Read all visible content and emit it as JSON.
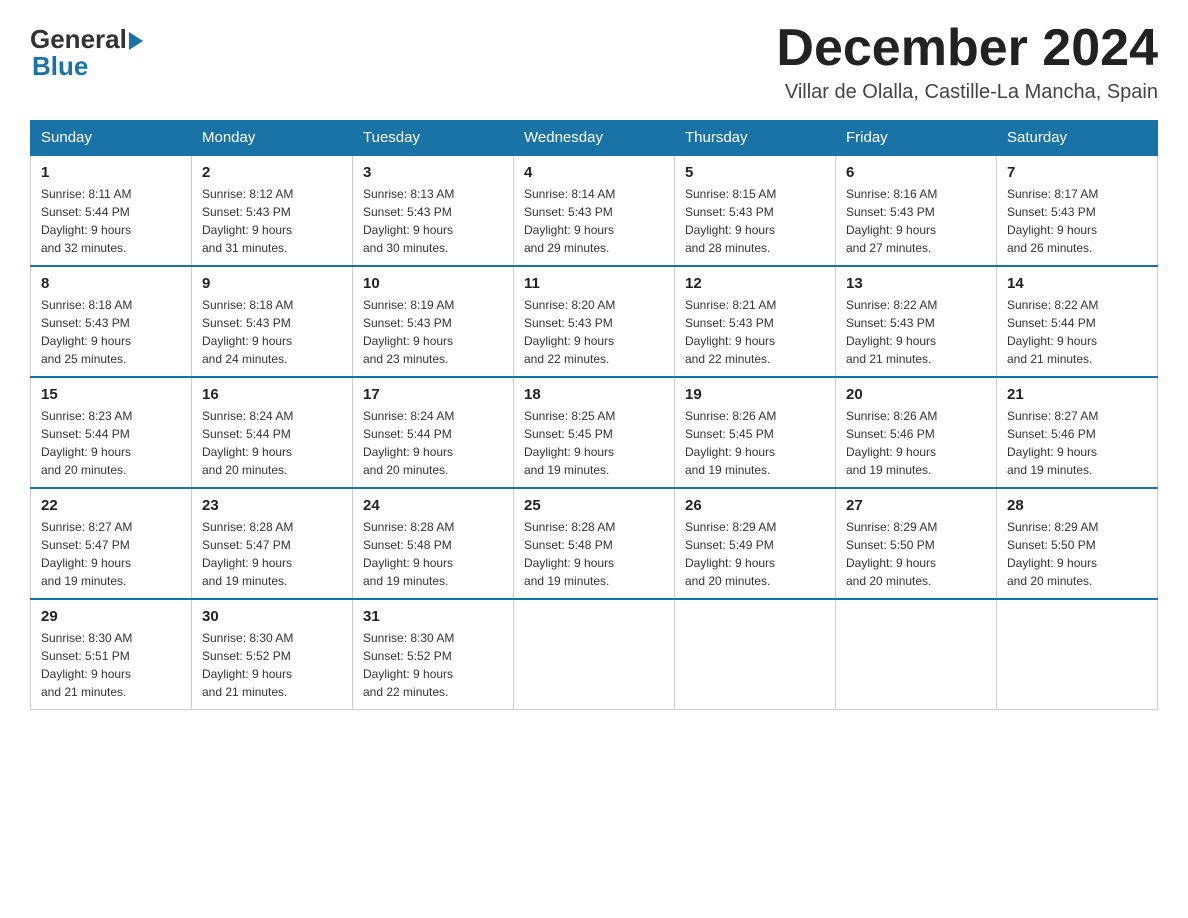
{
  "header": {
    "title": "December 2024",
    "location": "Villar de Olalla, Castille-La Mancha, Spain",
    "logo_general": "General",
    "logo_blue": "Blue"
  },
  "days_of_week": [
    "Sunday",
    "Monday",
    "Tuesday",
    "Wednesday",
    "Thursday",
    "Friday",
    "Saturday"
  ],
  "weeks": [
    [
      {
        "day": "1",
        "sunrise": "8:11 AM",
        "sunset": "5:44 PM",
        "daylight": "9 hours and 32 minutes."
      },
      {
        "day": "2",
        "sunrise": "8:12 AM",
        "sunset": "5:43 PM",
        "daylight": "9 hours and 31 minutes."
      },
      {
        "day": "3",
        "sunrise": "8:13 AM",
        "sunset": "5:43 PM",
        "daylight": "9 hours and 30 minutes."
      },
      {
        "day": "4",
        "sunrise": "8:14 AM",
        "sunset": "5:43 PM",
        "daylight": "9 hours and 29 minutes."
      },
      {
        "day": "5",
        "sunrise": "8:15 AM",
        "sunset": "5:43 PM",
        "daylight": "9 hours and 28 minutes."
      },
      {
        "day": "6",
        "sunrise": "8:16 AM",
        "sunset": "5:43 PM",
        "daylight": "9 hours and 27 minutes."
      },
      {
        "day": "7",
        "sunrise": "8:17 AM",
        "sunset": "5:43 PM",
        "daylight": "9 hours and 26 minutes."
      }
    ],
    [
      {
        "day": "8",
        "sunrise": "8:18 AM",
        "sunset": "5:43 PM",
        "daylight": "9 hours and 25 minutes."
      },
      {
        "day": "9",
        "sunrise": "8:18 AM",
        "sunset": "5:43 PM",
        "daylight": "9 hours and 24 minutes."
      },
      {
        "day": "10",
        "sunrise": "8:19 AM",
        "sunset": "5:43 PM",
        "daylight": "9 hours and 23 minutes."
      },
      {
        "day": "11",
        "sunrise": "8:20 AM",
        "sunset": "5:43 PM",
        "daylight": "9 hours and 22 minutes."
      },
      {
        "day": "12",
        "sunrise": "8:21 AM",
        "sunset": "5:43 PM",
        "daylight": "9 hours and 22 minutes."
      },
      {
        "day": "13",
        "sunrise": "8:22 AM",
        "sunset": "5:43 PM",
        "daylight": "9 hours and 21 minutes."
      },
      {
        "day": "14",
        "sunrise": "8:22 AM",
        "sunset": "5:44 PM",
        "daylight": "9 hours and 21 minutes."
      }
    ],
    [
      {
        "day": "15",
        "sunrise": "8:23 AM",
        "sunset": "5:44 PM",
        "daylight": "9 hours and 20 minutes."
      },
      {
        "day": "16",
        "sunrise": "8:24 AM",
        "sunset": "5:44 PM",
        "daylight": "9 hours and 20 minutes."
      },
      {
        "day": "17",
        "sunrise": "8:24 AM",
        "sunset": "5:44 PM",
        "daylight": "9 hours and 20 minutes."
      },
      {
        "day": "18",
        "sunrise": "8:25 AM",
        "sunset": "5:45 PM",
        "daylight": "9 hours and 19 minutes."
      },
      {
        "day": "19",
        "sunrise": "8:26 AM",
        "sunset": "5:45 PM",
        "daylight": "9 hours and 19 minutes."
      },
      {
        "day": "20",
        "sunrise": "8:26 AM",
        "sunset": "5:46 PM",
        "daylight": "9 hours and 19 minutes."
      },
      {
        "day": "21",
        "sunrise": "8:27 AM",
        "sunset": "5:46 PM",
        "daylight": "9 hours and 19 minutes."
      }
    ],
    [
      {
        "day": "22",
        "sunrise": "8:27 AM",
        "sunset": "5:47 PM",
        "daylight": "9 hours and 19 minutes."
      },
      {
        "day": "23",
        "sunrise": "8:28 AM",
        "sunset": "5:47 PM",
        "daylight": "9 hours and 19 minutes."
      },
      {
        "day": "24",
        "sunrise": "8:28 AM",
        "sunset": "5:48 PM",
        "daylight": "9 hours and 19 minutes."
      },
      {
        "day": "25",
        "sunrise": "8:28 AM",
        "sunset": "5:48 PM",
        "daylight": "9 hours and 19 minutes."
      },
      {
        "day": "26",
        "sunrise": "8:29 AM",
        "sunset": "5:49 PM",
        "daylight": "9 hours and 20 minutes."
      },
      {
        "day": "27",
        "sunrise": "8:29 AM",
        "sunset": "5:50 PM",
        "daylight": "9 hours and 20 minutes."
      },
      {
        "day": "28",
        "sunrise": "8:29 AM",
        "sunset": "5:50 PM",
        "daylight": "9 hours and 20 minutes."
      }
    ],
    [
      {
        "day": "29",
        "sunrise": "8:30 AM",
        "sunset": "5:51 PM",
        "daylight": "9 hours and 21 minutes."
      },
      {
        "day": "30",
        "sunrise": "8:30 AM",
        "sunset": "5:52 PM",
        "daylight": "9 hours and 21 minutes."
      },
      {
        "day": "31",
        "sunrise": "8:30 AM",
        "sunset": "5:52 PM",
        "daylight": "9 hours and 22 minutes."
      },
      null,
      null,
      null,
      null
    ]
  ],
  "labels": {
    "sunrise": "Sunrise:",
    "sunset": "Sunset:",
    "daylight": "Daylight:"
  }
}
